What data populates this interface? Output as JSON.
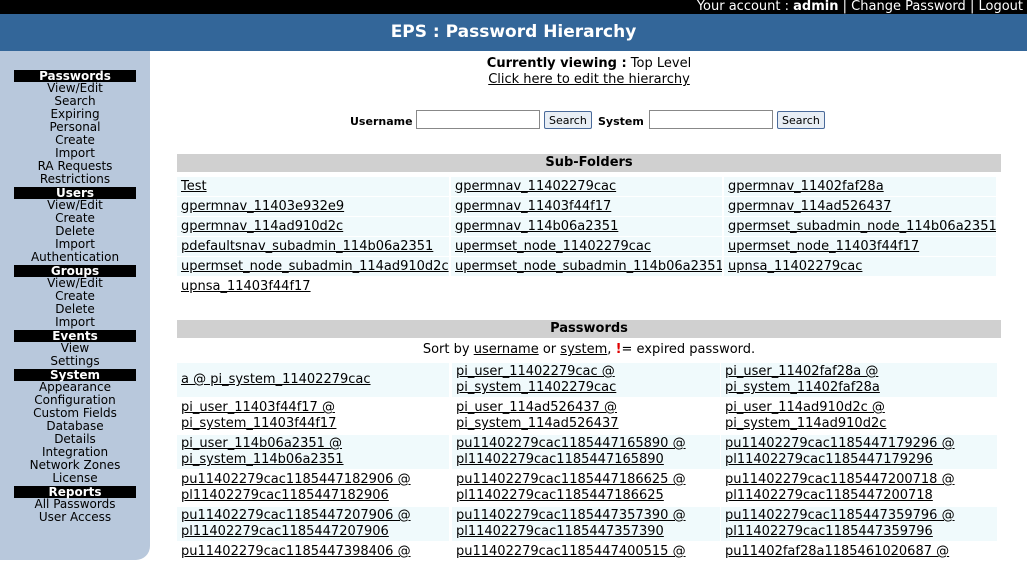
{
  "topbar": {
    "your_account_label": "Your account :",
    "username": "admin",
    "sep1": "|",
    "change_password": "Change Password",
    "sep2": "|",
    "logout": "Logout"
  },
  "title": "EPS : Password Hierarchy",
  "sidebar": {
    "sections": [
      {
        "head": "Passwords",
        "items": [
          "View/Edit",
          "Search",
          "Expiring",
          "Personal",
          "Create",
          "Import",
          "RA Requests",
          "Restrictions"
        ]
      },
      {
        "head": "Users",
        "items": [
          "View/Edit",
          "Create",
          "Delete",
          "Import",
          "Authentication"
        ]
      },
      {
        "head": "Groups",
        "items": [
          "View/Edit",
          "Create",
          "Delete",
          "Import"
        ]
      },
      {
        "head": "Events",
        "items": [
          "View",
          "Settings"
        ]
      },
      {
        "head": "System",
        "items": [
          "Appearance",
          "Configuration",
          "Custom Fields",
          "Database",
          "Details",
          "Integration",
          "Network Zones",
          "License"
        ]
      },
      {
        "head": "Reports",
        "items": [
          "All Passwords",
          "User Access"
        ]
      }
    ]
  },
  "viewing": {
    "label": "Currently viewing :",
    "value": "Top Level",
    "edit_link": "Click here to edit the hierarchy"
  },
  "search": {
    "username_label": "Username",
    "username_value": "",
    "system_label": "System",
    "system_value": "",
    "button1": "Search",
    "button2": "Search"
  },
  "subfolders": {
    "heading": "Sub-Folders",
    "rows": [
      [
        "Test",
        "gpermnav_11402279cac",
        "gpermnav_11402faf28a"
      ],
      [
        "gpermnav_11403e932e9",
        "gpermnav_11403f44f17",
        "gpermnav_114ad526437"
      ],
      [
        "gpermnav_114ad910d2c",
        "gpermnav_114b06a2351",
        "gpermset_subadmin_node_114b06a2351"
      ],
      [
        "pdefaultsnav_subadmin_114b06a2351",
        "upermset_node_11402279cac",
        "upermset_node_11403f44f17"
      ],
      [
        "upermset_node_subadmin_114ad910d2c",
        "upermset_node_subadmin_114b06a2351",
        "upnsa_11402279cac"
      ],
      [
        "upnsa_11403f44f17",
        "",
        ""
      ]
    ]
  },
  "passwords": {
    "heading": "Passwords",
    "sort_prefix": "Sort by",
    "sort_username": "username",
    "sort_or": "or",
    "sort_system": "system",
    "sort_comma": ",",
    "expired_mark": "!",
    "expired_text": "= expired password.",
    "rows": [
      [
        [
          "a @ pi_system_11402279cac"
        ],
        [
          "pi_user_11402279cac @",
          "pi_system_11402279cac"
        ],
        [
          "pi_user_11402faf28a @",
          "pi_system_11402faf28a"
        ]
      ],
      [
        [
          "pi_user_11403f44f17 @",
          "pi_system_11403f44f17"
        ],
        [
          "pi_user_114ad526437 @",
          "pi_system_114ad526437"
        ],
        [
          "pi_user_114ad910d2c @",
          "pi_system_114ad910d2c"
        ]
      ],
      [
        [
          "pi_user_114b06a2351 @",
          "pi_system_114b06a2351"
        ],
        [
          "pu11402279cac1185447165890 @",
          "pl11402279cac1185447165890"
        ],
        [
          "pu11402279cac1185447179296 @",
          "pl11402279cac1185447179296"
        ]
      ],
      [
        [
          "pu11402279cac1185447182906 @",
          "pl11402279cac1185447182906"
        ],
        [
          "pu11402279cac1185447186625 @",
          "pl11402279cac1185447186625"
        ],
        [
          "pu11402279cac1185447200718 @",
          "pl11402279cac1185447200718"
        ]
      ],
      [
        [
          "pu11402279cac1185447207906 @",
          "pl11402279cac1185447207906"
        ],
        [
          "pu11402279cac1185447357390 @",
          "pl11402279cac1185447357390"
        ],
        [
          "pu11402279cac1185447359796 @",
          "pl11402279cac1185447359796"
        ]
      ],
      [
        [
          "pu11402279cac1185447398406 @",
          ""
        ],
        [
          "pu11402279cac1185447400515 @",
          ""
        ],
        [
          "pu11402faf28a1185461020687 @",
          ""
        ]
      ]
    ]
  }
}
